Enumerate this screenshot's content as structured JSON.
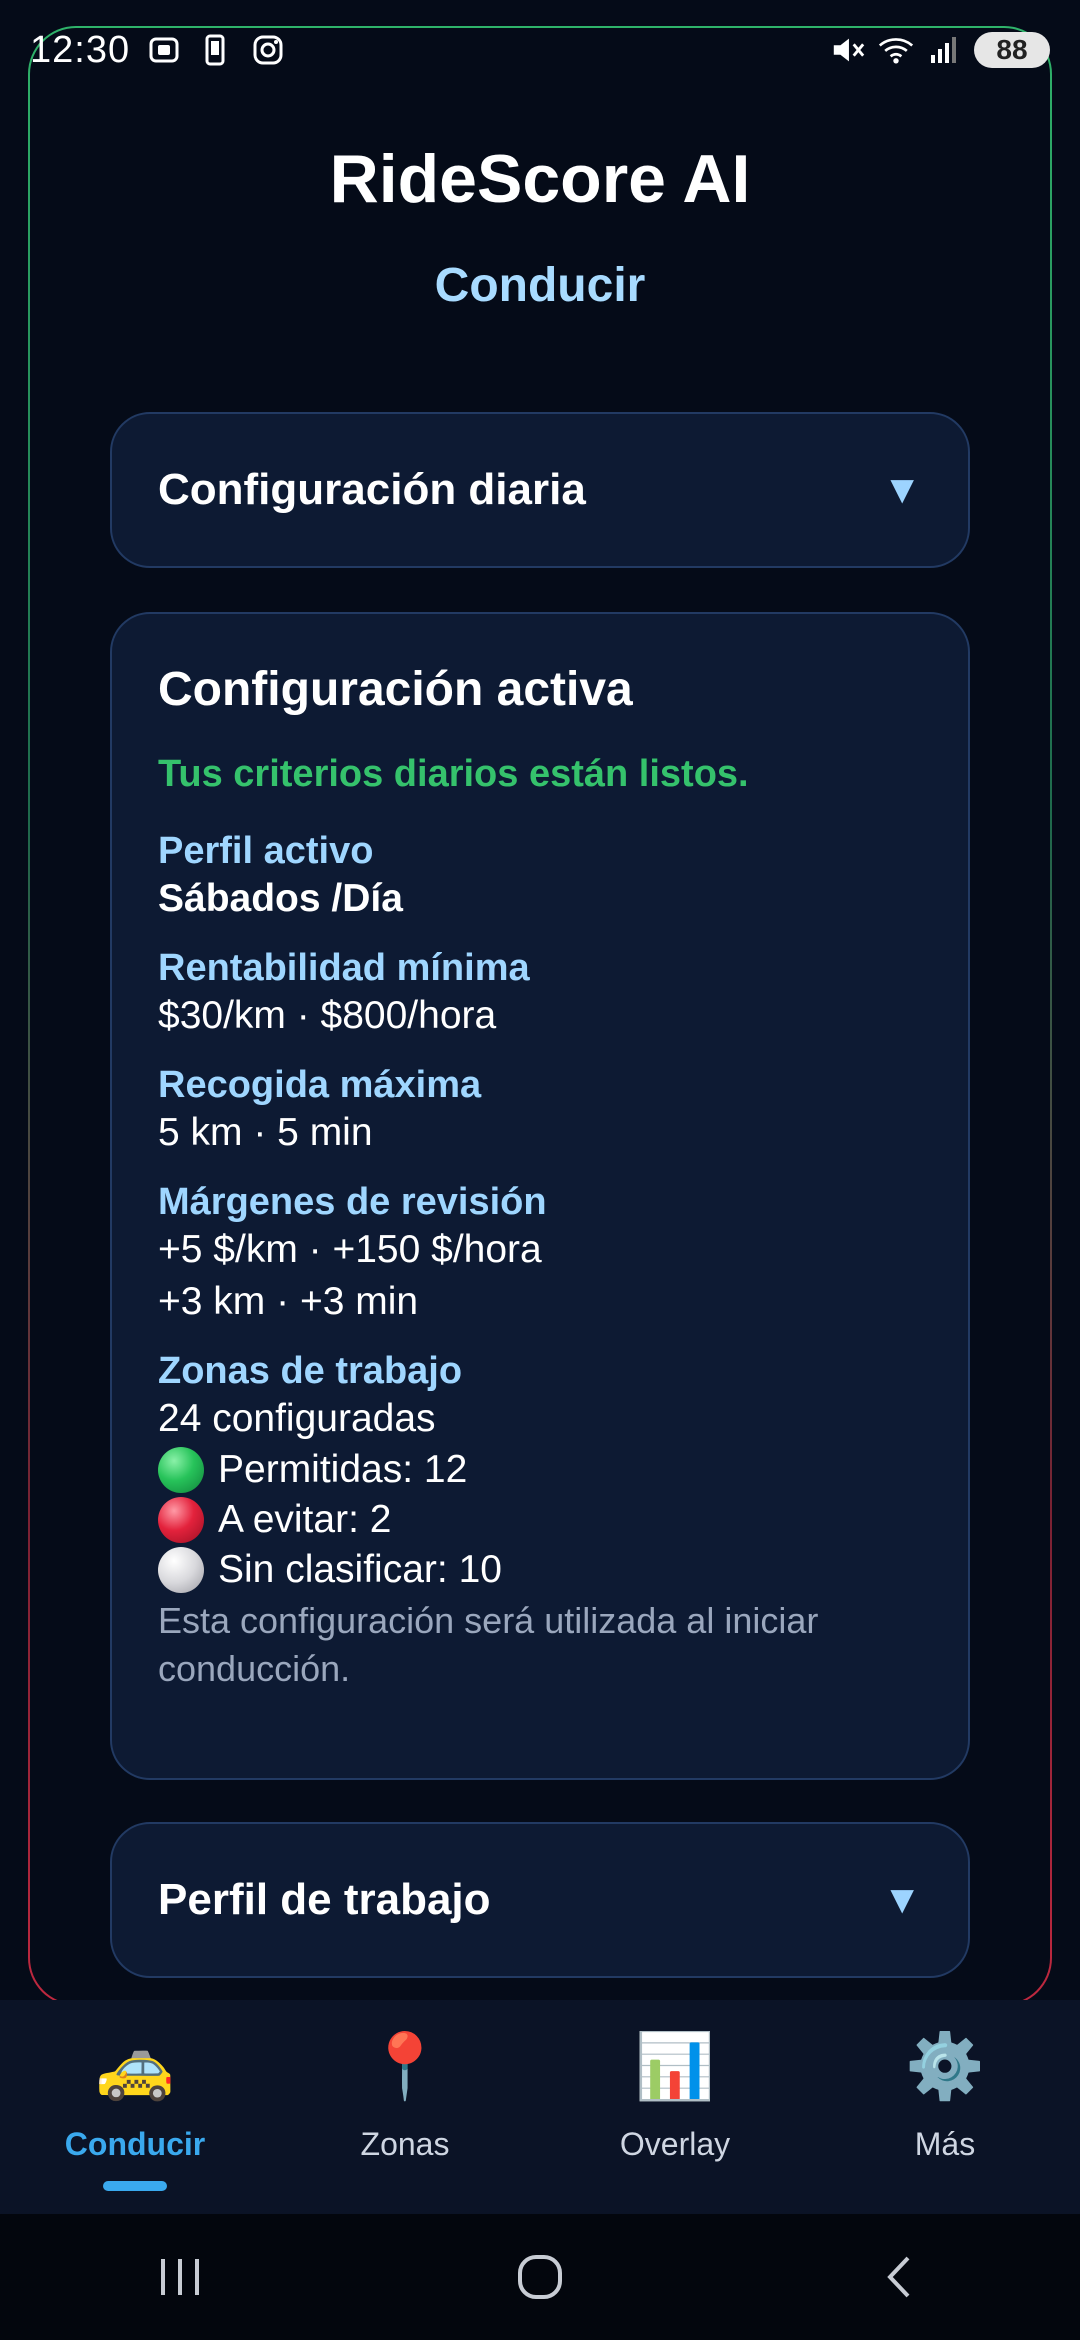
{
  "status_bar": {
    "time": "12:30",
    "battery": "88"
  },
  "header": {
    "title": "RideScore AI",
    "subtitle": "Conducir"
  },
  "daily_config_card": {
    "title": "Configuración diaria",
    "chevron": "▼"
  },
  "active_config": {
    "title": "Configuración activa",
    "ready_message": "Tus criterios diarios están listos.",
    "profile_label": "Perfil activo",
    "profile_value": "Sábados /Día",
    "profitability_label": "Rentabilidad mínima",
    "profitability_value": "$30/km · $800/hora",
    "pickup_label": "Recogida máxima",
    "pickup_value": "5 km · 5 min",
    "margins_label": "Márgenes de revisión",
    "margins_line1": "+5 $/km · +150 $/hora",
    "margins_line2": "+3 km · +3 min",
    "zones_label": "Zonas de trabajo",
    "zones_count": "24 configuradas",
    "zones_allowed": "Permitidas: 12",
    "zones_avoid": "A evitar: 2",
    "zones_unclassified": "Sin clasificar: 10",
    "note": "Esta configuración será utilizada al iniciar conducción."
  },
  "work_profile_card": {
    "title": "Perfil de trabajo",
    "chevron": "▼"
  },
  "bottom_nav": {
    "items": [
      {
        "label": "Conducir",
        "icon": "🚕",
        "icon_name": "taxi-icon"
      },
      {
        "label": "Zonas",
        "icon": "📍",
        "icon_name": "pin-icon"
      },
      {
        "label": "Overlay",
        "icon": "📊",
        "icon_name": "bar-chart-icon"
      },
      {
        "label": "Más",
        "icon": "⚙️",
        "icon_name": "gear-icon"
      }
    ]
  },
  "colors": {
    "accent": "#3aa9ee",
    "success": "#35c26c",
    "label": "#9fd6ff"
  }
}
